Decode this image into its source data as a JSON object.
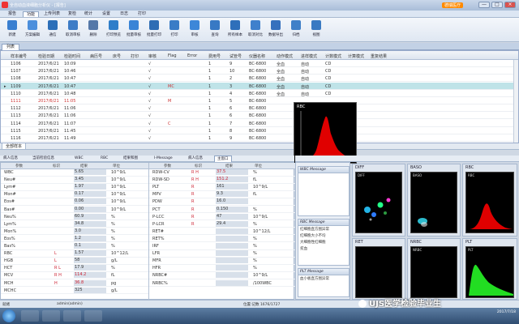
{
  "window": {
    "title": "全自动血液细胞分析仪 - [报告]",
    "brand_badge": "德瑞医疗",
    "min": "—",
    "max": "□",
    "close": "×"
  },
  "menu": [
    "报告",
    "功能",
    "上传列表",
    "复检",
    "统计",
    "设置",
    "日志",
    "打印"
  ],
  "menu_active_index": 1,
  "toolbar": [
    {
      "label": "新建",
      "icon": "new-icon",
      "color": "#3a7fd0"
    },
    {
      "label": "方案编辑",
      "icon": "edit-icon",
      "color": "#4c8fdc"
    },
    {
      "label": "通信",
      "icon": "comm-icon",
      "color": "#2c6fb8"
    },
    {
      "label": "取消审核",
      "icon": "unreview-icon",
      "color": "#3d7cc6"
    },
    {
      "label": "删除",
      "icon": "delete-icon",
      "color": "#5578a8"
    },
    {
      "label": "打印预览",
      "icon": "preview-icon",
      "color": "#2f7ec9"
    },
    {
      "label": "批量审核",
      "icon": "batch-review-icon",
      "color": "#3a84d6"
    },
    {
      "label": "批量打印",
      "icon": "batch-print-icon",
      "color": "#2e6db4"
    },
    {
      "label": "打印",
      "icon": "print-icon",
      "color": "#3a7cc6"
    },
    {
      "label": "审核",
      "icon": "review-icon",
      "color": "#3d87d8"
    },
    {
      "label": "查询",
      "icon": "query-icon",
      "color": "#3879c4"
    },
    {
      "label": "所有样本",
      "icon": "all-samples-icon",
      "color": "#2e6fba"
    },
    {
      "label": "取消对比",
      "icon": "uncompare-icon",
      "color": "#3f80cc"
    },
    {
      "label": "数据导出",
      "icon": "export-icon",
      "color": "#3570bd"
    },
    {
      "label": "归档",
      "icon": "archive-icon",
      "color": "#4080c8"
    },
    {
      "label": "视图",
      "icon": "view-icon",
      "color": "#3a7ac2"
    }
  ],
  "list_tab": "列表",
  "grid": {
    "columns": [
      "样本编号",
      "检验日期",
      "检验时间",
      "病历号",
      "床号",
      "打印",
      "审核",
      "Flag",
      "Error",
      "费用号",
      "试管号",
      "仪器名称",
      "动作模式",
      "进样模式",
      "计数模式",
      "计算模式",
      "重复结果"
    ],
    "rows": [
      {
        "id": "1106",
        "date": "2017/6/21",
        "time": "10:09",
        "print": "",
        "review": "√",
        "flag": "",
        "err": "",
        "fee": "1",
        "tube": "9",
        "inst": "BC-6800",
        "act": "全血",
        "feed": "自动",
        "count": "CD",
        "red": false,
        "selected": false
      },
      {
        "id": "1107",
        "date": "2017/6/21",
        "time": "10:46",
        "print": "",
        "review": "√",
        "flag": "",
        "err": "",
        "fee": "1",
        "tube": "10",
        "inst": "BC-6800",
        "act": "全血",
        "feed": "自动",
        "count": "CD",
        "red": false,
        "selected": false
      },
      {
        "id": "1108",
        "date": "2017/6/21",
        "time": "10:47",
        "print": "",
        "review": "√",
        "flag": "",
        "err": "",
        "fee": "1",
        "tube": "2",
        "inst": "BC-6800",
        "act": "全血",
        "feed": "自动",
        "count": "CD",
        "red": false,
        "selected": false
      },
      {
        "id": "1109",
        "date": "2017/6/21",
        "time": "10:47",
        "print": "",
        "review": "√",
        "flag": "MC",
        "err": "",
        "fee": "1",
        "tube": "3",
        "inst": "BC-6800",
        "act": "全血",
        "feed": "自动",
        "count": "CD",
        "red": false,
        "selected": true
      },
      {
        "id": "1110",
        "date": "2017/6/21",
        "time": "10:48",
        "print": "",
        "review": "√",
        "flag": "",
        "err": "",
        "fee": "1",
        "tube": "4",
        "inst": "BC-6800",
        "act": "全血",
        "feed": "自动",
        "count": "CD",
        "red": false,
        "selected": false
      },
      {
        "id": "1111",
        "date": "2017/6/21",
        "time": "11:05",
        "print": "",
        "review": "√",
        "flag": "M",
        "err": "",
        "fee": "1",
        "tube": "5",
        "inst": "BC-6800",
        "act": "",
        "feed": "",
        "count": "",
        "red": true,
        "selected": false
      },
      {
        "id": "1112",
        "date": "2017/6/21",
        "time": "11:06",
        "print": "",
        "review": "√",
        "flag": "",
        "err": "",
        "fee": "1",
        "tube": "6",
        "inst": "BC-6800",
        "act": "",
        "feed": "",
        "count": "",
        "red": false,
        "selected": false
      },
      {
        "id": "1113",
        "date": "2017/6/21",
        "time": "11:06",
        "print": "",
        "review": "√",
        "flag": "",
        "err": "",
        "fee": "1",
        "tube": "6",
        "inst": "BC-6800",
        "act": "",
        "feed": "",
        "count": "",
        "red": false,
        "selected": false
      },
      {
        "id": "1114",
        "date": "2017/6/21",
        "time": "11:07",
        "print": "",
        "review": "√",
        "flag": "C",
        "err": "",
        "fee": "1",
        "tube": "7",
        "inst": "BC-6800",
        "act": "",
        "feed": "",
        "count": "",
        "red": false,
        "selected": false
      },
      {
        "id": "1115",
        "date": "2017/6/21",
        "time": "11:45",
        "print": "",
        "review": "√",
        "flag": "",
        "err": "",
        "fee": "1",
        "tube": "8",
        "inst": "BC-6800",
        "act": "",
        "feed": "",
        "count": "",
        "red": false,
        "selected": false
      },
      {
        "id": "1116",
        "date": "2017/6/21",
        "time": "11:49",
        "print": "",
        "review": "√",
        "flag": "",
        "err": "",
        "fee": "1",
        "tube": "9",
        "inst": "BC-6800",
        "act": "",
        "feed": "",
        "count": "",
        "red": false,
        "selected": false
      }
    ]
  },
  "grid_footer_tab": "全部样本",
  "popup": {
    "label": "RBC"
  },
  "lower_tabs": [
    "病人信息",
    "当前检验信息",
    "WBC",
    "RBC",
    "结果和图",
    "I-Message",
    "病人信息",
    "主窗口"
  ],
  "lower_tabs_active": 7,
  "params": {
    "head": [
      "参数",
      "标识",
      "结果",
      "单位"
    ],
    "col1": [
      {
        "n": "WBC",
        "f": "",
        "v": "5.65",
        "u": "10^9/L",
        "red": false
      },
      {
        "n": "Neu#",
        "f": "",
        "v": "3.45",
        "u": "10^9/L",
        "red": false
      },
      {
        "n": "Lym#",
        "f": "",
        "v": "1.97",
        "u": "10^9/L",
        "red": false
      },
      {
        "n": "Mon#",
        "f": "",
        "v": "0.17",
        "u": "10^9/L",
        "red": false
      },
      {
        "n": "Eos#",
        "f": "",
        "v": "0.06",
        "u": "10^9/L",
        "red": false
      },
      {
        "n": "Bas#",
        "f": "",
        "v": "0.00",
        "u": "10^9/L",
        "red": false
      },
      {
        "n": "Neu%",
        "f": "",
        "v": "60.9",
        "u": "%",
        "red": false
      },
      {
        "n": "Lym%",
        "f": "",
        "v": "34.8",
        "u": "%",
        "red": false
      },
      {
        "n": "Mon%",
        "f": "",
        "v": "3.0",
        "u": "%",
        "red": false
      },
      {
        "n": "Eos%",
        "f": "",
        "v": "1.2",
        "u": "%",
        "red": false
      },
      {
        "n": "Bas%",
        "f": "",
        "v": "0.1",
        "u": "%",
        "red": false
      },
      {
        "n": "RBC",
        "f": "L",
        "v": "1.57",
        "u": "10^12/L",
        "red": false
      },
      {
        "n": "HGB",
        "f": "L",
        "v": "58",
        "u": "g/L",
        "red": false
      },
      {
        "n": "HCT",
        "f": "R   L",
        "v": "17.9",
        "u": "%",
        "red": false
      },
      {
        "n": "MCV",
        "f": "R   H",
        "v": "114.2",
        "u": "fL",
        "red": true
      },
      {
        "n": "MCH",
        "f": "H",
        "v": "36.8",
        "u": "pg",
        "red": true
      },
      {
        "n": "MCHC",
        "f": "",
        "v": "325",
        "u": "g/L",
        "red": false
      }
    ],
    "col2": [
      {
        "n": "RDW-CV",
        "f": "R   H",
        "v": "37.5",
        "u": "%",
        "red": true
      },
      {
        "n": "RDW-SD",
        "f": "R   H",
        "v": "151.2",
        "u": "fL",
        "red": true
      },
      {
        "n": "PLT",
        "f": "R",
        "v": "161",
        "u": "10^9/L",
        "red": false
      },
      {
        "n": "MPV",
        "f": "R",
        "v": "9.3",
        "u": "fL",
        "red": false
      },
      {
        "n": "PDW",
        "f": "R",
        "v": "16.0",
        "u": "",
        "red": false
      },
      {
        "n": "PCT",
        "f": "R",
        "v": "0.150",
        "u": "%",
        "red": false
      },
      {
        "n": "P-LCC",
        "f": "R",
        "v": "47",
        "u": "10^9/L",
        "red": false
      },
      {
        "n": "P-LCR",
        "f": "R",
        "v": "29.4",
        "u": "%",
        "red": false
      },
      {
        "n": "RET#",
        "f": "",
        "v": "",
        "u": "10^12/L",
        "red": false
      },
      {
        "n": "RET%",
        "f": "",
        "v": "",
        "u": "%",
        "red": false
      },
      {
        "n": "IRF",
        "f": "",
        "v": "",
        "u": "%",
        "red": false
      },
      {
        "n": "LFR",
        "f": "",
        "v": "",
        "u": "%",
        "red": false
      },
      {
        "n": "MFR",
        "f": "",
        "v": "",
        "u": "%",
        "red": false
      },
      {
        "n": "HFR",
        "f": "",
        "v": "",
        "u": "%",
        "red": false
      },
      {
        "n": "NRBC#",
        "f": "",
        "v": "",
        "u": "10^9/L",
        "red": false
      },
      {
        "n": "NRBC%",
        "f": "",
        "v": "",
        "u": "/100WBC",
        "red": false
      }
    ]
  },
  "messages": {
    "wbc_title": "WBC Message",
    "rbc_title": "RBC Message",
    "rbc_lines": [
      "红细胞直方图异常",
      "红细胞大小不均",
      "大细胞性红细胞",
      "贫血"
    ],
    "plt_title": "PLT Message",
    "plt_lines": [
      "血小板直方图异常"
    ]
  },
  "scatters": {
    "diff": "DIFF",
    "baso": "BASO",
    "rbc": "RBC",
    "ret": "RET",
    "nrbc": "NRBC",
    "plt": "PLT",
    "diff_in": "DIFF",
    "baso_in": "BASO",
    "rbc_in": "RBC",
    "nrbc_in": "NRBC",
    "plt_in": "PLT"
  },
  "status": {
    "left": "就绪",
    "user": "admin(admin)",
    "center": "位置:记数 1676/1727"
  },
  "watermark": "UJS医学检验毕业生",
  "clock": "2017/7/18"
}
